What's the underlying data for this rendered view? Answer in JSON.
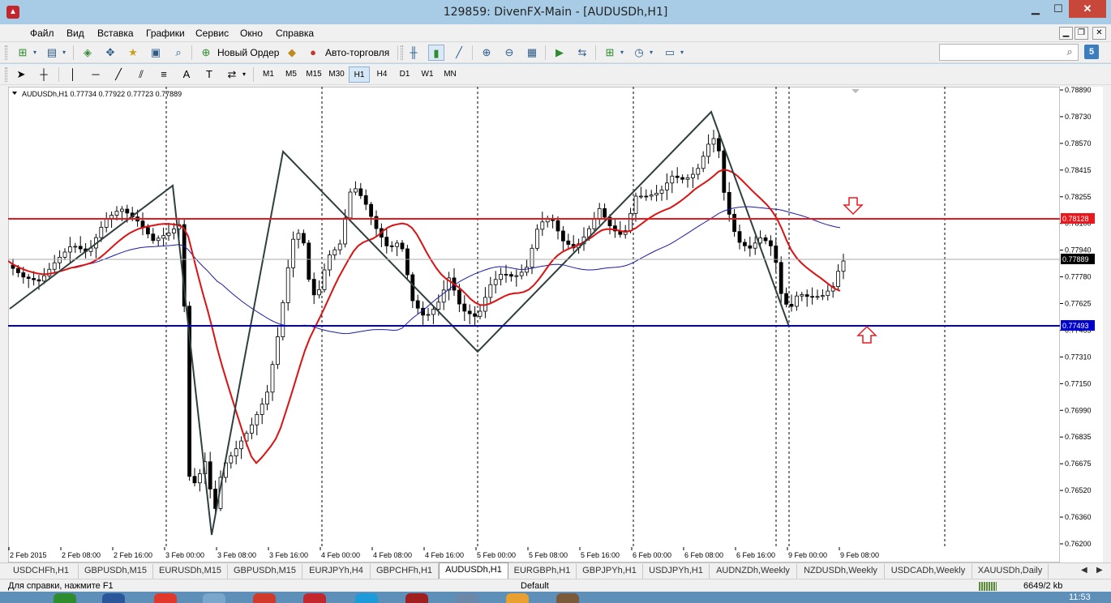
{
  "window": {
    "title": "129859: DivenFX-Main - [AUDUSDh,H1]",
    "app_icon": "metatrader-icon"
  },
  "menu": [
    "Файл",
    "Вид",
    "Вставка",
    "Графики",
    "Сервис",
    "Окно",
    "Справка"
  ],
  "toolbar": {
    "new_order_label": "Новый Ордер",
    "auto_trading_label": "Авто-торговля",
    "search_placeholder": "",
    "badge_count": "5"
  },
  "timeframes": [
    "M1",
    "M5",
    "M15",
    "M30",
    "H1",
    "H4",
    "D1",
    "W1",
    "MN"
  ],
  "active_timeframe": "H1",
  "chart": {
    "header": "AUDUSDh,H1  0.77734  0.77922  0.77723  0.77889",
    "price_axis": [
      "0.78890",
      "0.78730",
      "0.78570",
      "0.78415",
      "0.78255",
      "0.78100",
      "0.77940",
      "0.77780",
      "0.77625",
      "0.77465",
      "0.77310",
      "0.77150",
      "0.76990",
      "0.76835",
      "0.76675",
      "0.76520",
      "0.76360",
      "0.76200"
    ],
    "time_axis": [
      "2 Feb 2015",
      "2 Feb 08:00",
      "2 Feb 16:00",
      "3 Feb 00:00",
      "3 Feb 08:00",
      "3 Feb 16:00",
      "4 Feb 00:00",
      "4 Feb 08:00",
      "4 Feb 16:00",
      "5 Feb 00:00",
      "5 Feb 08:00",
      "5 Feb 16:00",
      "6 Feb 00:00",
      "6 Feb 08:00",
      "6 Feb 16:00",
      "9 Feb 00:00",
      "9 Feb 08:00"
    ],
    "resistance_label": "0.78128",
    "support_label": "0.77493",
    "current_price_label": "0.77889",
    "colors": {
      "resistance": "#e8191e",
      "support": "#0000cc",
      "ma_fast": "#dd1111",
      "ma_slow": "#1a1aa8",
      "zigzag": "#2f3f3f",
      "arrow": "#e8191e"
    }
  },
  "tabs": [
    "USDCHFh,H1",
    "GBPUSDh,M15",
    "EURUSDh,M15",
    "GBPUSDh,M15",
    "EURJPYh,H4",
    "GBPCHFh,H1",
    "AUDUSDh,H1",
    "EURGBPh,H1",
    "GBPJPYh,H1",
    "USDJPYh,H1",
    "AUDNZDh,Weekly",
    "NZDUSDh,Weekly",
    "USDCADh,Weekly",
    "XAUUSDh,Daily"
  ],
  "active_tab": "AUDUSDh,H1",
  "status": {
    "help": "Для справки, нажмите F1",
    "profile": "Default",
    "traffic": "6649/2 kb"
  },
  "taskbar": {
    "clock": "11:53"
  }
}
